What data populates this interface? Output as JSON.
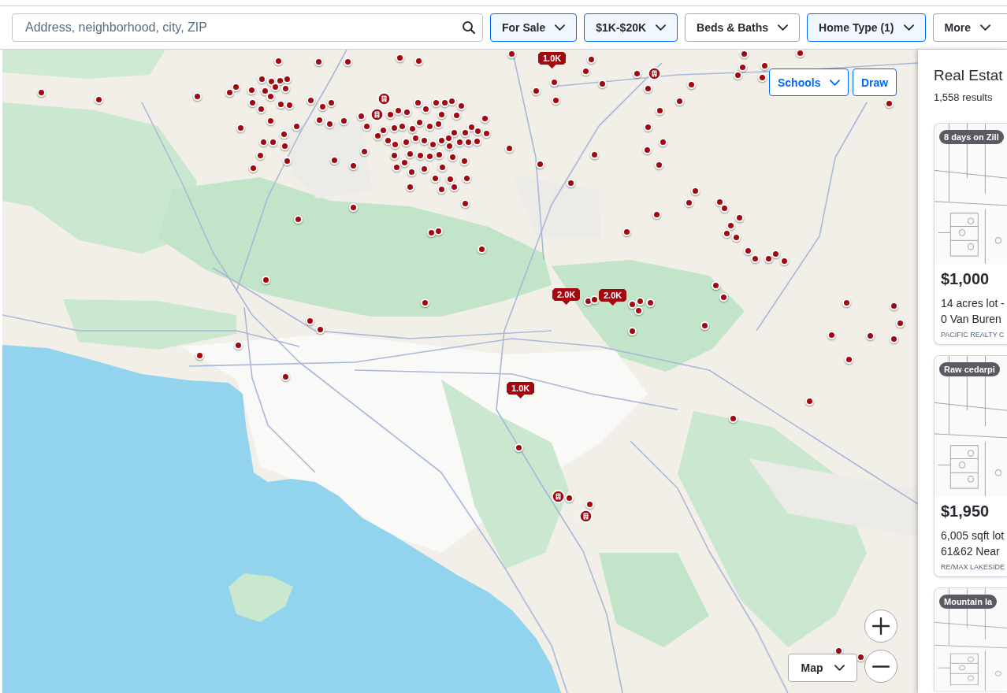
{
  "header": {
    "search": {
      "placeholder": "Address, neighborhood, city, ZIP"
    },
    "filters": [
      {
        "label": "For Sale",
        "active": true
      },
      {
        "label": "$1K-$20K",
        "active": true
      },
      {
        "label": "Beds & Baths",
        "active": false
      },
      {
        "label": "Home Type (1)",
        "active": true
      },
      {
        "label": "More",
        "active": false
      }
    ]
  },
  "map": {
    "overlay_buttons": [
      {
        "label": "Schools",
        "kind": "dropdown"
      },
      {
        "label": "Draw",
        "kind": "button"
      }
    ],
    "price_markers": [
      {
        "label": "1.0K"
      },
      {
        "label": "2.0K"
      },
      {
        "label": "2.0K"
      },
      {
        "label": "1.0K"
      }
    ],
    "map_type_button": {
      "label": "Map"
    }
  },
  "results": {
    "title": "Real Estat",
    "count": "1,558 results",
    "listings": [
      {
        "badge": "8 days on Zill",
        "price": "$1,000",
        "details": "14 acres lot -",
        "address": "0 Van Buren",
        "broker": "PACIFIC REALTY C"
      },
      {
        "badge": "Raw cedarpi",
        "price": "$1,950",
        "details": "6,005 sqft lot",
        "address": "61&62 Near",
        "broker": "RE/MAX LAKESIDE"
      },
      {
        "badge": "Mountain la"
      }
    ]
  }
}
